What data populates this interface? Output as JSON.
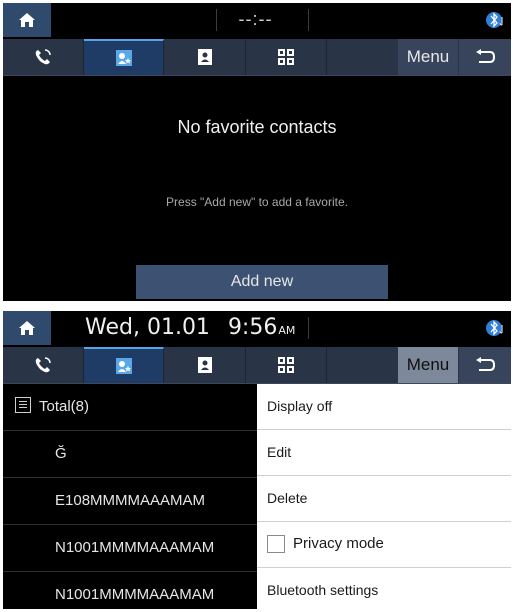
{
  "screen1": {
    "clock": "--:--",
    "tabs": [
      {
        "icon": "call-history-icon"
      },
      {
        "icon": "favorites-icon",
        "active": true
      },
      {
        "icon": "contacts-icon"
      },
      {
        "icon": "dial-pad-icon"
      }
    ],
    "menu_label": "Menu",
    "empty_title": "No favorite contacts",
    "empty_hint": "Press \"Add new\" to add a favorite.",
    "add_new_label": "Add new"
  },
  "screen2": {
    "date": "Wed, 01.01",
    "time": "9:56",
    "ampm": "AM",
    "menu_label": "Menu",
    "list": [
      {
        "label": "Total(8)"
      },
      {
        "label": "Ğ"
      },
      {
        "label": "E108MMMMAAAMAM"
      },
      {
        "label": "N1001MMMMAAAMAM"
      },
      {
        "label": "N1001MMMMAAAMAM"
      }
    ],
    "menu_items": [
      {
        "label": "Display off"
      },
      {
        "label": "Edit"
      },
      {
        "label": "Delete"
      },
      {
        "label": "Privacy mode",
        "checked": false
      },
      {
        "label": "Bluetooth settings"
      }
    ]
  },
  "colors": {
    "background": "#000000",
    "home_button": "#2f4a6d",
    "tab_bar": "#2a3447",
    "tab_active": "#1f3c67",
    "tab_active_accent": "#56a4ea",
    "add_button": "#3d5272",
    "menu_panel": "#ffffff",
    "bluetooth": "#4aa3ff"
  }
}
